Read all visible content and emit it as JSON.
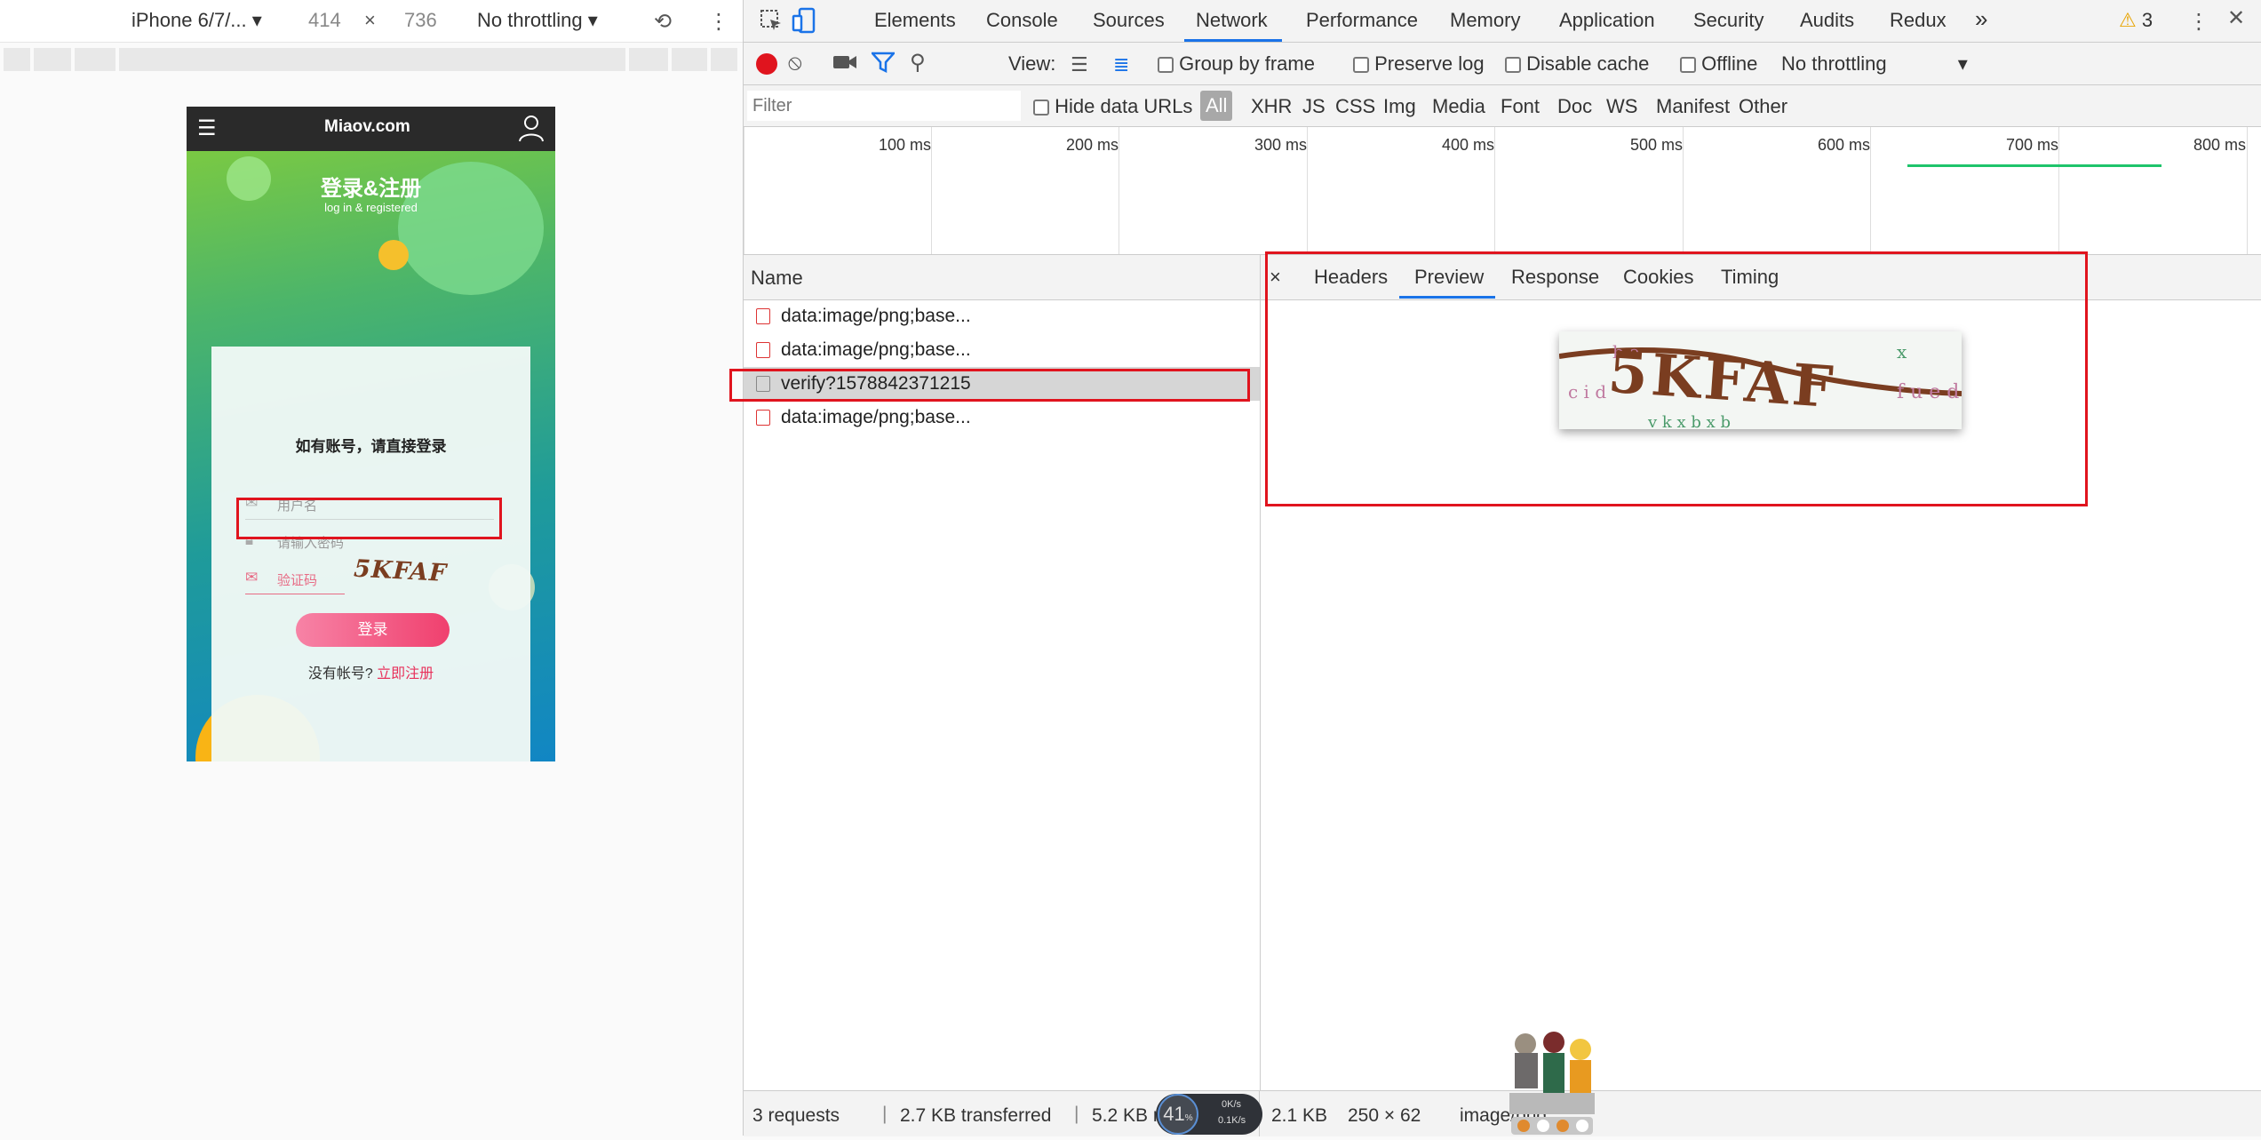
{
  "device_toolbar": {
    "device": "iPhone 6/7/...",
    "width": "414",
    "times": "×",
    "height": "736",
    "throttling": "No throttling"
  },
  "phone": {
    "logo": "Miaov.com",
    "title": "登录&注册",
    "subtitle": "log in & registered",
    "heading": "如有账号，请直接登录",
    "username_placeholder": "用户名",
    "password_placeholder": "请输入密码",
    "captcha_placeholder": "验证码",
    "captcha_text": "5KFAF",
    "login_button": "登录",
    "no_account": "没有帐号?",
    "register_link": "立即注册"
  },
  "devtools": {
    "tabs": [
      "Elements",
      "Console",
      "Sources",
      "Network",
      "Performance",
      "Memory",
      "Application",
      "Security",
      "Audits",
      "Redux"
    ],
    "active_tab": "Network",
    "more": "»",
    "warning_count": "3",
    "toolbar": {
      "view_label": "View:",
      "group_by_frame": "Group by frame",
      "preserve_log": "Preserve log",
      "disable_cache": "Disable cache",
      "offline": "Offline",
      "throttling": "No throttling"
    },
    "filter": {
      "placeholder": "Filter",
      "hide_data_urls": "Hide data URLs",
      "types": [
        "All",
        "XHR",
        "JS",
        "CSS",
        "Img",
        "Media",
        "Font",
        "Doc",
        "WS",
        "Manifest",
        "Other"
      ]
    },
    "timeline_ticks": [
      "100 ms",
      "200 ms",
      "300 ms",
      "400 ms",
      "500 ms",
      "600 ms",
      "700 ms",
      "800 ms"
    ],
    "name_header": "Name",
    "requests": [
      "data:image/png;base...",
      "data:image/png;base...",
      "verify?1578842371215",
      "data:image/png;base..."
    ],
    "detail_tabs": [
      "Headers",
      "Preview",
      "Response",
      "Cookies",
      "Timing"
    ],
    "active_detail_tab": "Preview",
    "close": "×",
    "preview_captcha": "5KFAF",
    "status": {
      "requests": "3 requests",
      "transferred": "2.7 KB transferred",
      "resources": "5.2 KB resourc",
      "size": "2.1 KB",
      "dimensions": "250 × 62",
      "mime": "image/png"
    },
    "widget": {
      "value": "41",
      "unit": "%",
      "up": "0K/s",
      "down": "0.1K/s"
    }
  },
  "colors": {
    "accent": "#1a73e8",
    "highlight": "#e0141e",
    "record": "#e0141e",
    "login_button": "#f45b8e",
    "timing_bar": "#1ec46b"
  }
}
